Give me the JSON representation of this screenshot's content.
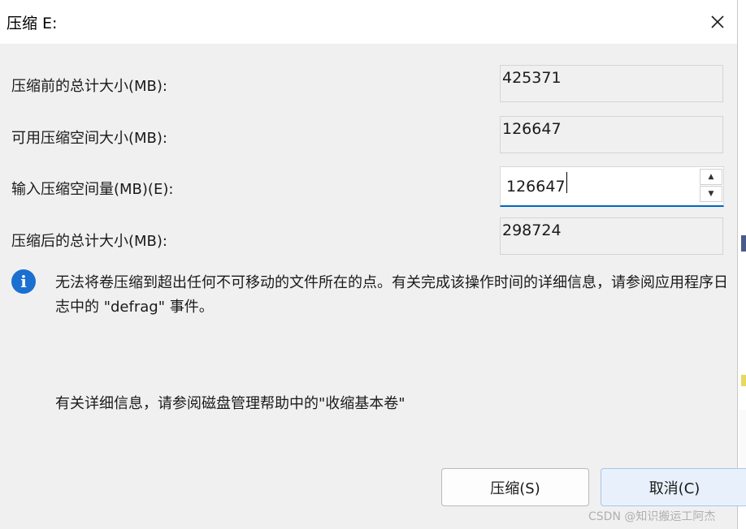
{
  "dialog": {
    "title": "压缩 E:",
    "close_glyph": "✕"
  },
  "fields": {
    "total_before_label": "压缩前的总计大小(MB):",
    "total_before_value": "425371",
    "available_label": "可用压缩空间大小(MB):",
    "available_value": "126647",
    "amount_label": "输入压缩空间量(MB)(E):",
    "amount_value": "126647",
    "total_after_label": "压缩后的总计大小(MB):",
    "total_after_value": "298724"
  },
  "info": {
    "icon": "info-icon",
    "icon_glyph": "i",
    "text": "无法将卷压缩到超出任何不可移动的文件所在的点。有关完成该操作时间的详细信息，请参阅应用程序日志中的 \"defrag\" 事件。"
  },
  "help": {
    "text": "有关详细信息，请参阅磁盘管理帮助中的\"收缩基本卷\""
  },
  "buttons": {
    "shrink_label": "压缩(S)",
    "cancel_label": "取消(C)"
  },
  "spinner": {
    "up_glyph": "▲",
    "down_glyph": "▼"
  },
  "watermark": "CSDN @知识搬运工阿杰",
  "colors": {
    "accent": "#0067c0",
    "info_icon": "#1a6fd0"
  }
}
